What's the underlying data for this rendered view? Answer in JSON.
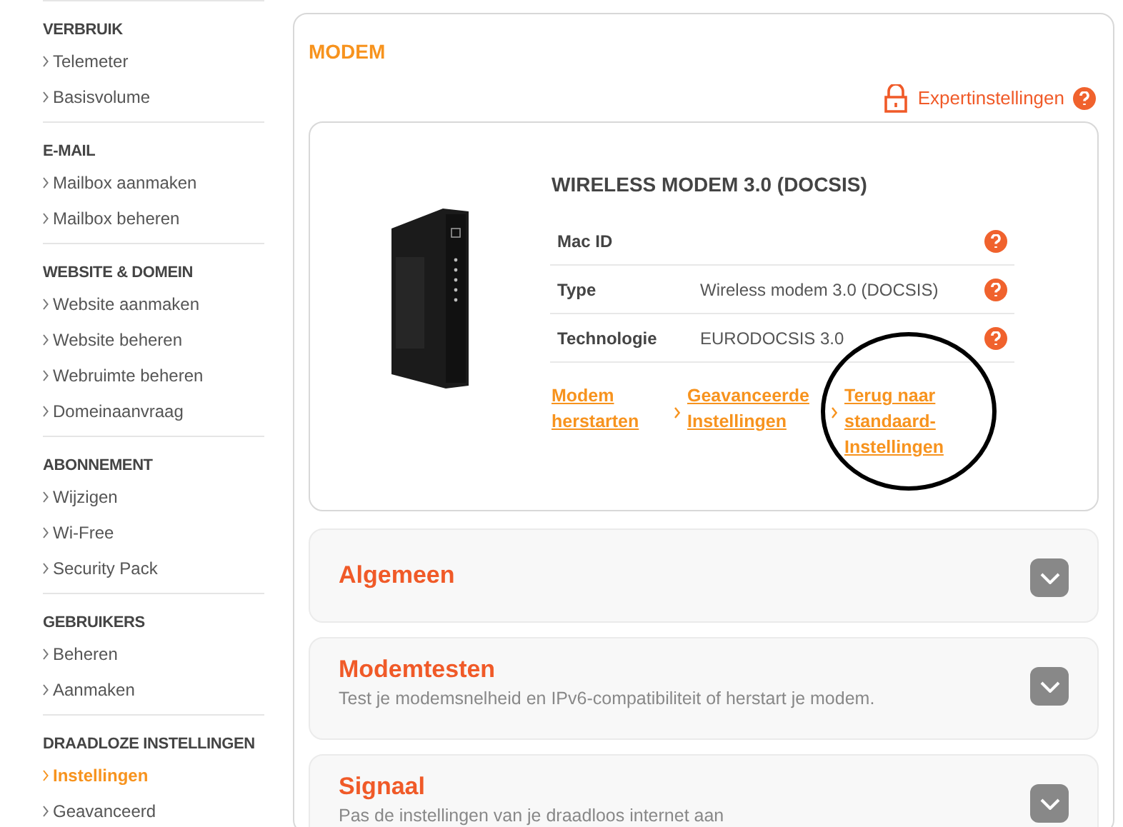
{
  "sidebar": {
    "sections": [
      {
        "title": "VERBRUIK",
        "items": [
          {
            "label": "Telemeter",
            "selected": false
          },
          {
            "label": "Basisvolume",
            "selected": false
          }
        ]
      },
      {
        "title": "E-MAIL",
        "items": [
          {
            "label": "Mailbox aanmaken",
            "selected": false
          },
          {
            "label": "Mailbox beheren",
            "selected": false
          }
        ]
      },
      {
        "title": "WEBSITE & DOMEIN",
        "items": [
          {
            "label": "Website aanmaken",
            "selected": false
          },
          {
            "label": "Website beheren",
            "selected": false
          },
          {
            "label": "Webruimte beheren",
            "selected": false
          },
          {
            "label": "Domeinaanvraag",
            "selected": false
          }
        ]
      },
      {
        "title": "ABONNEMENT",
        "items": [
          {
            "label": "Wijzigen",
            "selected": false
          },
          {
            "label": "Wi-Free",
            "selected": false
          },
          {
            "label": "Security Pack",
            "selected": false
          }
        ]
      },
      {
        "title": "GEBRUIKERS",
        "items": [
          {
            "label": "Beheren",
            "selected": false
          },
          {
            "label": "Aanmaken",
            "selected": false
          }
        ]
      },
      {
        "title": "DRAADLOZE INSTELLINGEN",
        "items": [
          {
            "label": "Instellingen",
            "selected": true
          },
          {
            "label": "Geavanceerd",
            "selected": false
          }
        ]
      }
    ]
  },
  "panel": {
    "title": "MODEM",
    "expert_link": "Expertinstellingen",
    "modem": {
      "name": "WIRELESS MODEM 3.0 (DOCSIS)",
      "specs": [
        {
          "label": "Mac ID"
        },
        {
          "label": "Type",
          "value": "Wireless modem 3.0 (DOCSIS)"
        },
        {
          "label": "Technologie",
          "value": "EURODOCSIS 3.0"
        }
      ],
      "actions": [
        {
          "lines": [
            "Modem",
            "herstarten"
          ],
          "circled": false
        },
        {
          "lines": [
            "Geavanceerde",
            "Instellingen"
          ],
          "circled": false
        },
        {
          "lines": [
            "Terug naar",
            "standaard-",
            "Instellingen"
          ],
          "circled": true
        }
      ]
    },
    "sections": [
      {
        "title": "Algemeen",
        "expanded": false
      },
      {
        "title": "Modemtesten",
        "subtitle": "Test je modemsnelheid en IPv6-compatibiliteit of herstart je modem.",
        "expanded": false
      },
      {
        "title": "Signaal",
        "subtitle": "Pas de instellingen van je draadloos internet aan",
        "expanded": false
      }
    ]
  }
}
